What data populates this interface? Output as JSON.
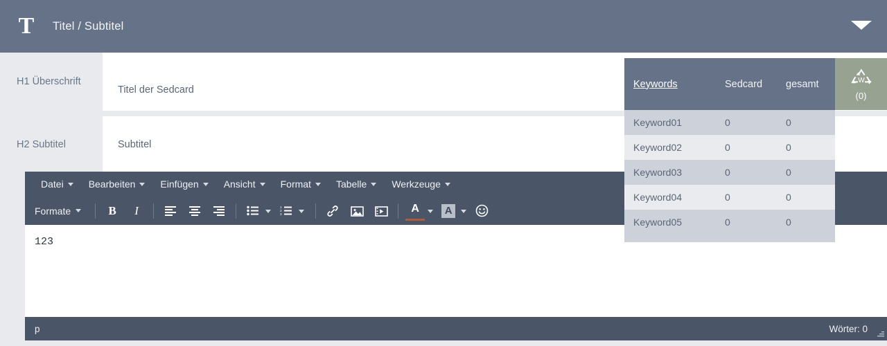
{
  "header": {
    "logo_glyph": "T",
    "logo_icon": "serif-t-logo",
    "title": "Titel / Subtitel",
    "collapse_icon": "caret-down-icon"
  },
  "form": {
    "rows": [
      {
        "label": "H1 Überschrift",
        "value": "Titel der Sedcard",
        "placeholder": "Titel der Sedcard"
      },
      {
        "label": "H2 Subtitel",
        "value": "Subtitel",
        "placeholder": "Subtitel"
      }
    ]
  },
  "keywords_panel": {
    "columns": [
      "Keywords",
      "Sedcard",
      "gesamt"
    ],
    "rows": [
      {
        "keyword": "Keyword01",
        "sedcard": "0",
        "gesamt": "0"
      },
      {
        "keyword": "Keyword02",
        "sedcard": "0",
        "gesamt": "0"
      },
      {
        "keyword": "Keyword03",
        "sedcard": "0",
        "gesamt": "0"
      },
      {
        "keyword": "Keyword04",
        "sedcard": "0",
        "gesamt": "0"
      },
      {
        "keyword": "Keyword05",
        "sedcard": "0",
        "gesamt": "0"
      }
    ]
  },
  "recycle_badge": {
    "icon": "recycle-w-icon",
    "glyph": "W",
    "count": "(0)",
    "background_color": "#97a291"
  },
  "editor": {
    "menubar": [
      {
        "label": "Datei"
      },
      {
        "label": "Bearbeiten"
      },
      {
        "label": "Einfügen"
      },
      {
        "label": "Ansicht"
      },
      {
        "label": "Format"
      },
      {
        "label": "Tabelle"
      },
      {
        "label": "Werkzeuge"
      }
    ],
    "toolbar": {
      "formats_label": "Formate",
      "bold_label": "B",
      "italic_label": "I",
      "text_color_label": "A",
      "bg_color_label": "A",
      "buttons": [
        "formats-dropdown",
        "bold-button",
        "italic-button",
        "align-left-button",
        "align-center-button",
        "align-right-button",
        "bullet-list-button",
        "bullet-list-dropdown",
        "numbered-list-button",
        "numbered-list-dropdown",
        "link-button",
        "image-button",
        "media-button",
        "text-color-button",
        "text-color-dropdown",
        "background-color-button",
        "background-color-dropdown",
        "emoticon-button"
      ]
    },
    "content": "123",
    "status": {
      "path": "p",
      "word_count": "Wörter: 0",
      "resize_icon": "resize-grip-icon"
    }
  },
  "colors": {
    "header_bg": "#667288",
    "toolbar_bg": "#4a5568",
    "page_bg": "#e8eaee",
    "row_odd": "#ccd1da",
    "row_even": "#e9ebef",
    "badge_bg": "#97a291"
  }
}
